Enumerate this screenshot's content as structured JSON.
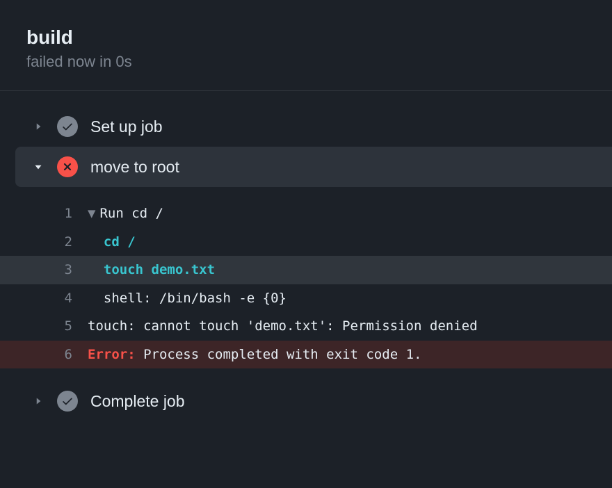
{
  "header": {
    "title": "build",
    "status": "failed now in 0s"
  },
  "steps": [
    {
      "name": "Set up job",
      "status": "success",
      "expanded": false
    },
    {
      "name": "move to root",
      "status": "failure",
      "expanded": true
    },
    {
      "name": "Complete job",
      "status": "success",
      "expanded": false
    }
  ],
  "log": {
    "lines": [
      {
        "num": "1",
        "collapse": "▼",
        "text": "Run cd /",
        "type": "collapse-header"
      },
      {
        "num": "2",
        "text": "cd /",
        "type": "cmd",
        "indent": "  "
      },
      {
        "num": "3",
        "text": "touch demo.txt",
        "type": "cmd",
        "indent": "  ",
        "highlighted": true
      },
      {
        "num": "4",
        "text": "shell: /bin/bash -e {0}",
        "type": "plain",
        "indent": "  "
      },
      {
        "num": "5",
        "text": "touch: cannot touch 'demo.txt': Permission denied",
        "type": "plain"
      },
      {
        "num": "6",
        "label": "Error:",
        "text": " Process completed with exit code 1.",
        "type": "error"
      }
    ]
  }
}
